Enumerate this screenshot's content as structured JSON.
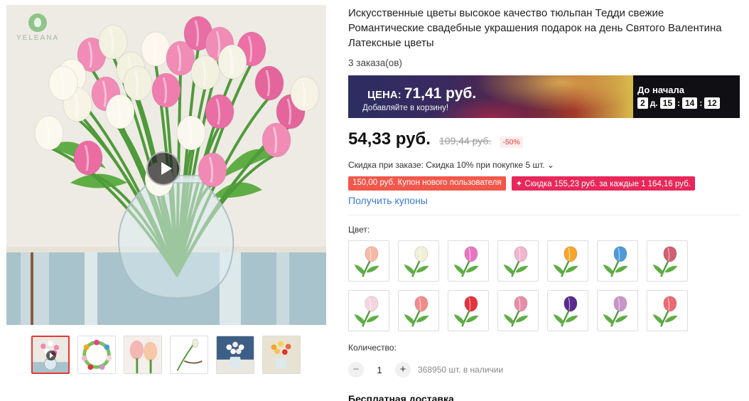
{
  "brand": {
    "logo_text": "YELEANA"
  },
  "product": {
    "title": "Искусственные цветы высокое качество тюльпан Тедди свежие Романтические свадебные украшения подарок на день Святого Валентина Латексные цветы",
    "orders": "3 заказа(ов)"
  },
  "banner": {
    "price_prefix": "ЦЕНА:",
    "price_value": "71,41 руб.",
    "subtitle": "Добавляйте в корзину!",
    "countdown_title": "До начала",
    "days": "2",
    "days_label": "д.",
    "hours": "15",
    "minutes": "14",
    "seconds": "12",
    "colors": {
      "countdown_bg": "#0f0f14"
    }
  },
  "pricing": {
    "current": "54,33 руб.",
    "old": "109,44 руб.",
    "discount": "-50%",
    "order_discount": "Скидка при заказе: Скидка 10% при покупке 5 шт. ⌄",
    "coupon_new_user": "150,00 руб. Купон нового пользователя",
    "coupon_every": "✦ Скидка 155,23 руб. за каждые 1 164,16 руб.",
    "get_coupons": "Получить купоны"
  },
  "options": {
    "color_label": "Цвет:",
    "colors": [
      {
        "name": "peach-tulip",
        "petal": "#f6b9a6"
      },
      {
        "name": "white-tulip",
        "petal": "#f1efd8"
      },
      {
        "name": "pink-purple-tulip",
        "petal": "#e776c2"
      },
      {
        "name": "light-pink-tulip",
        "petal": "#f1b5cf"
      },
      {
        "name": "yellow-orange-tulip",
        "petal": "#f6a62a"
      },
      {
        "name": "blue-tulip",
        "petal": "#4d9ad8"
      },
      {
        "name": "dark-pink-tulip",
        "petal": "#d35e73"
      },
      {
        "name": "pale-pink-tulip",
        "petal": "#f5d4e0"
      },
      {
        "name": "salmon-tulip",
        "petal": "#f08c8c"
      },
      {
        "name": "red-tulip",
        "petal": "#e2333c"
      },
      {
        "name": "rose-tulip",
        "petal": "#e68ea9"
      },
      {
        "name": "purple-tulip",
        "petal": "#5a2a8c"
      },
      {
        "name": "lilac-tulip",
        "petal": "#c994c8"
      },
      {
        "name": "coral-tulip",
        "petal": "#ec6a74"
      }
    ],
    "quantity_label": "Количество:",
    "quantity_value": "1",
    "minus": "−",
    "plus": "+",
    "stock": "368950 шт. в наличии"
  },
  "shipping": {
    "label": "Бесплатная доставка"
  },
  "colors": {
    "accent_red": "#e53935",
    "link_blue": "#3a79d6"
  }
}
